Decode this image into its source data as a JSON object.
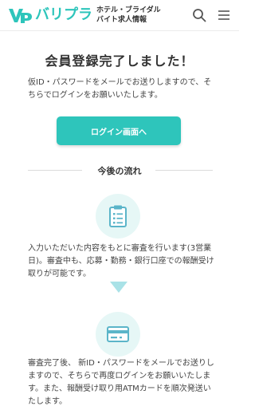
{
  "header": {
    "logo_text": "バリプラ",
    "tagline_line1": "ホテル・ブライダル",
    "tagline_line2": "バイト求人情報",
    "search_icon": "search-icon",
    "menu_icon": "hamburger-menu-icon"
  },
  "main": {
    "title": "会員登録完了しました！",
    "intro": "仮ID・パスワードをメールでお送りしますので、そちらでログインをお願いいたします。",
    "login_button": "ログイン画面へ"
  },
  "flow": {
    "heading": "今後の流れ",
    "steps": [
      {
        "icon": "clipboard-icon",
        "text": "入力いただいた内容をもとに審査を行います(3営業日)。審査中も、応募・勤務・銀行口座での報酬受け取りが可能です。"
      },
      {
        "icon": "credit-card-icon",
        "text": "審査完了後、 新ID・パスワードをメールでお送りしますので、そちらで再度ログインをお願いいたします。また、報酬受け取り用ATMカードを順次発送いたします。"
      }
    ]
  },
  "colors": {
    "accent": "#2ec5bb",
    "icon_bg": "#e6f7f6",
    "icon_stroke": "#5bb5c9",
    "arrow": "#a9e2e7"
  }
}
